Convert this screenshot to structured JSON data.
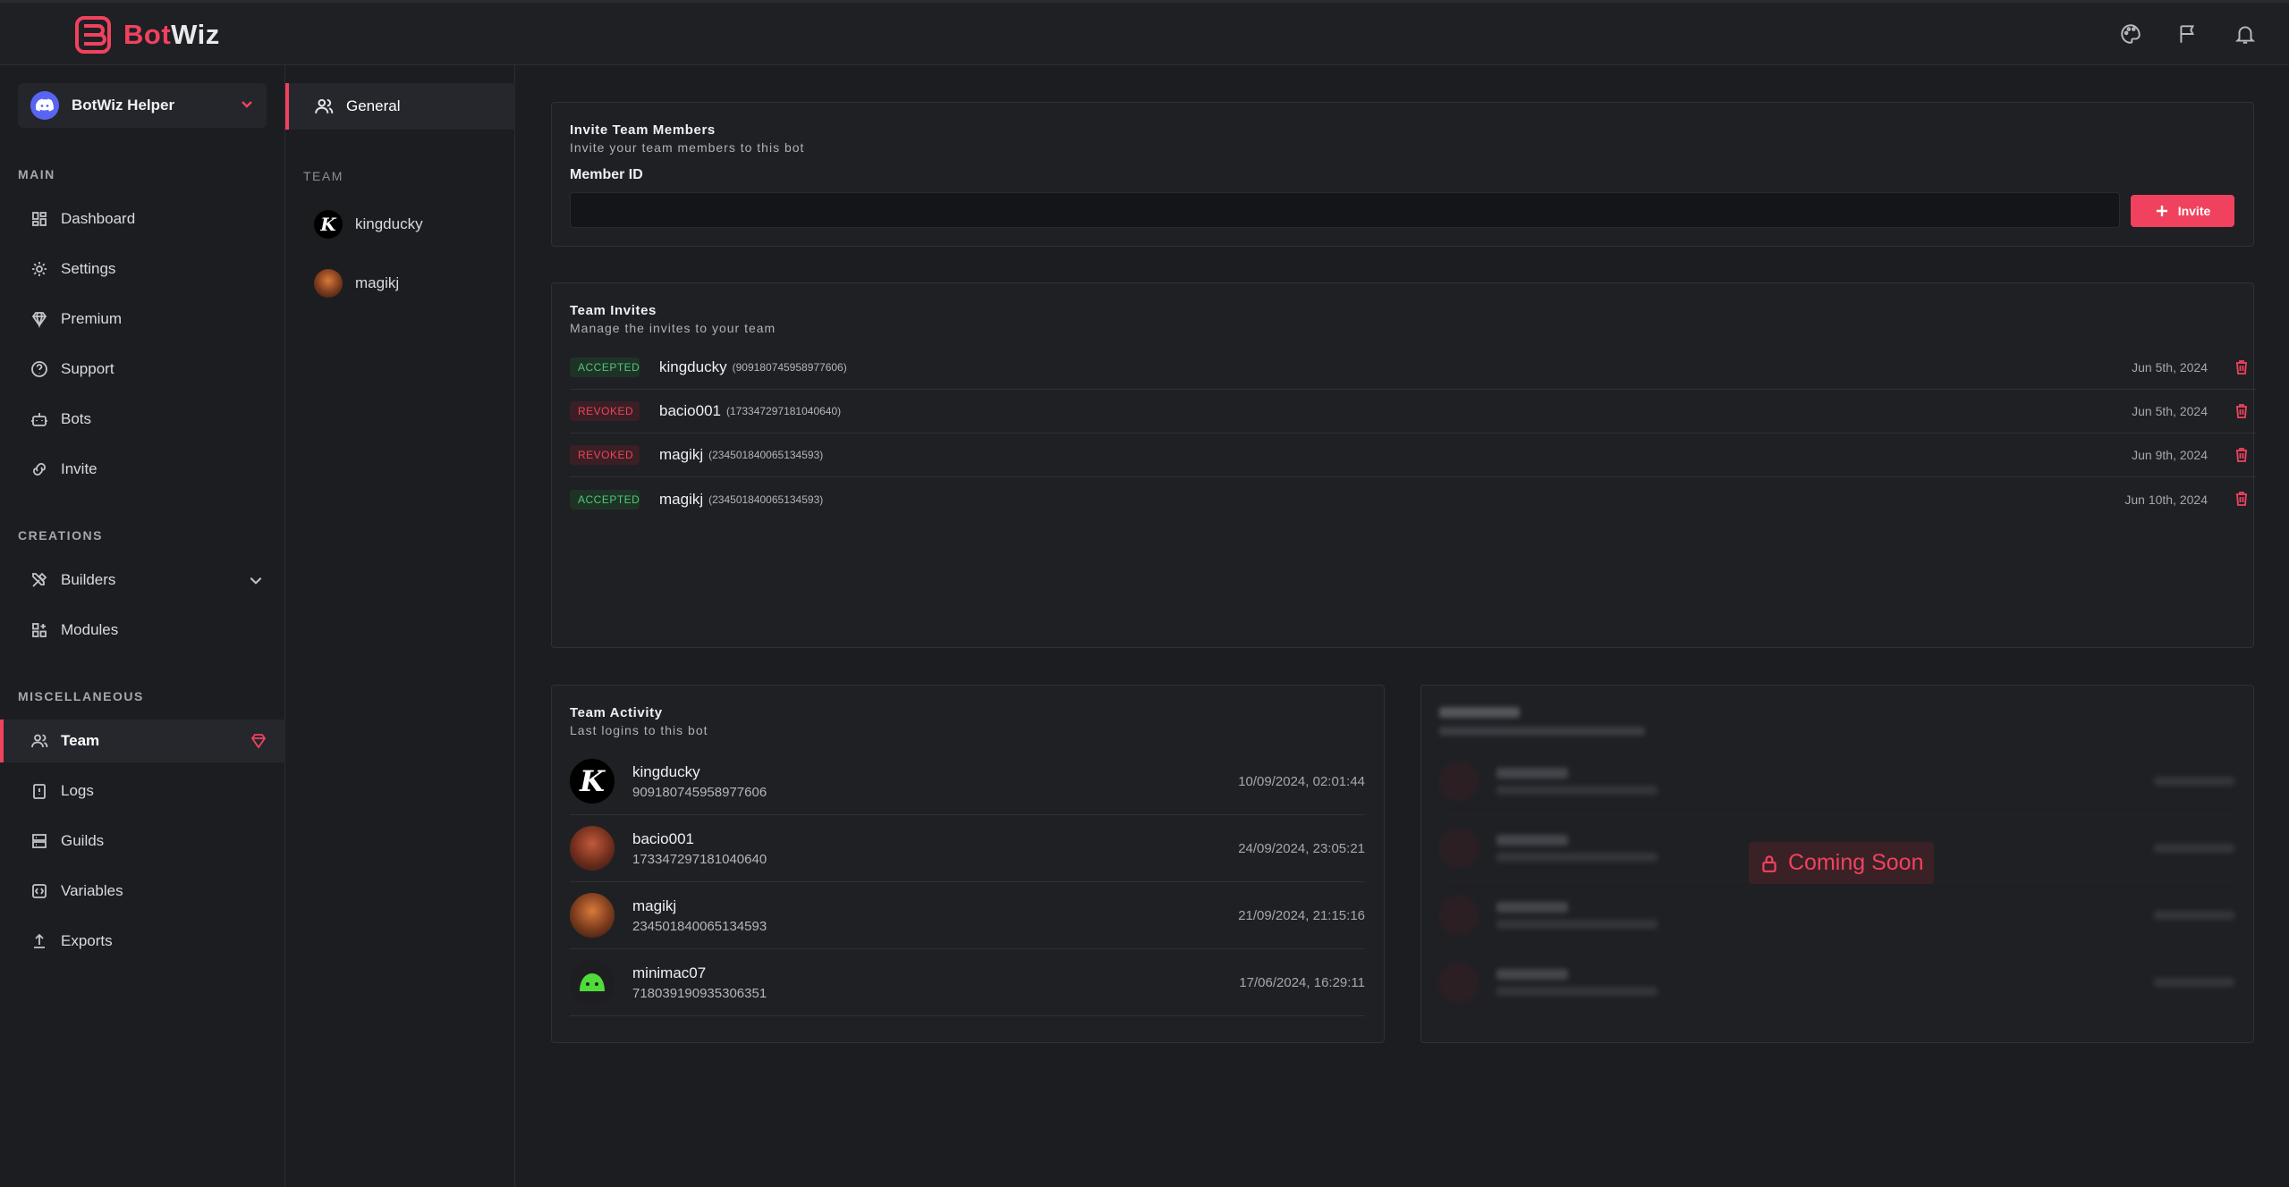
{
  "brand": {
    "part1": "Bot",
    "part2": "Wiz",
    "accent": "#f0425e"
  },
  "topbar": {
    "icons": [
      "palette-icon",
      "flag-icon",
      "bell-icon"
    ]
  },
  "bot_selector": {
    "name": "BotWiz Helper"
  },
  "sidebar": {
    "sections": {
      "main": "MAIN",
      "creations": "CREATIONS",
      "misc": "MISCELLANEOUS"
    },
    "items": {
      "dashboard": "Dashboard",
      "settings": "Settings",
      "premium": "Premium",
      "support": "Support",
      "bots": "Bots",
      "invite": "Invite",
      "builders": "Builders",
      "modules": "Modules",
      "team": "Team",
      "logs": "Logs",
      "guilds": "Guilds",
      "variables": "Variables",
      "exports": "Exports"
    }
  },
  "subnav": {
    "general": "General",
    "team_label": "TEAM",
    "members": [
      "kingducky",
      "magikj"
    ],
    "member_initial": "K"
  },
  "invite_card": {
    "title": "Invite Team Members",
    "subtitle": "Invite your team members to this bot",
    "field_label": "Member ID",
    "input_value": "",
    "button": "Invite"
  },
  "invites_card": {
    "title": "Team Invites",
    "subtitle": "Manage the invites to your team",
    "rows": [
      {
        "status": "ACCEPTED",
        "name": "kingducky",
        "id": "(909180745958977606)",
        "date": "Jun 5th, 2024"
      },
      {
        "status": "REVOKED",
        "name": "bacio001",
        "id": "(173347297181040640)",
        "date": "Jun 5th, 2024"
      },
      {
        "status": "REVOKED",
        "name": "magikj",
        "id": "(234501840065134593)",
        "date": "Jun 9th, 2024"
      },
      {
        "status": "ACCEPTED",
        "name": "magikj",
        "id": "(234501840065134593)",
        "date": "Jun 10th, 2024"
      }
    ]
  },
  "activity_card": {
    "title": "Team Activity",
    "subtitle": "Last logins to this bot",
    "rows": [
      {
        "name": "kingducky",
        "id": "909180745958977606",
        "time": "10/09/2024, 02:01:44"
      },
      {
        "name": "bacio001",
        "id": "173347297181040640",
        "time": "24/09/2024, 23:05:21"
      },
      {
        "name": "magikj",
        "id": "234501840065134593",
        "time": "21/09/2024, 21:15:16"
      },
      {
        "name": "minimac07",
        "id": "718039190935306351",
        "time": "17/06/2024, 16:29:11"
      }
    ]
  },
  "logs_card": {
    "badge": "Coming Soon"
  }
}
